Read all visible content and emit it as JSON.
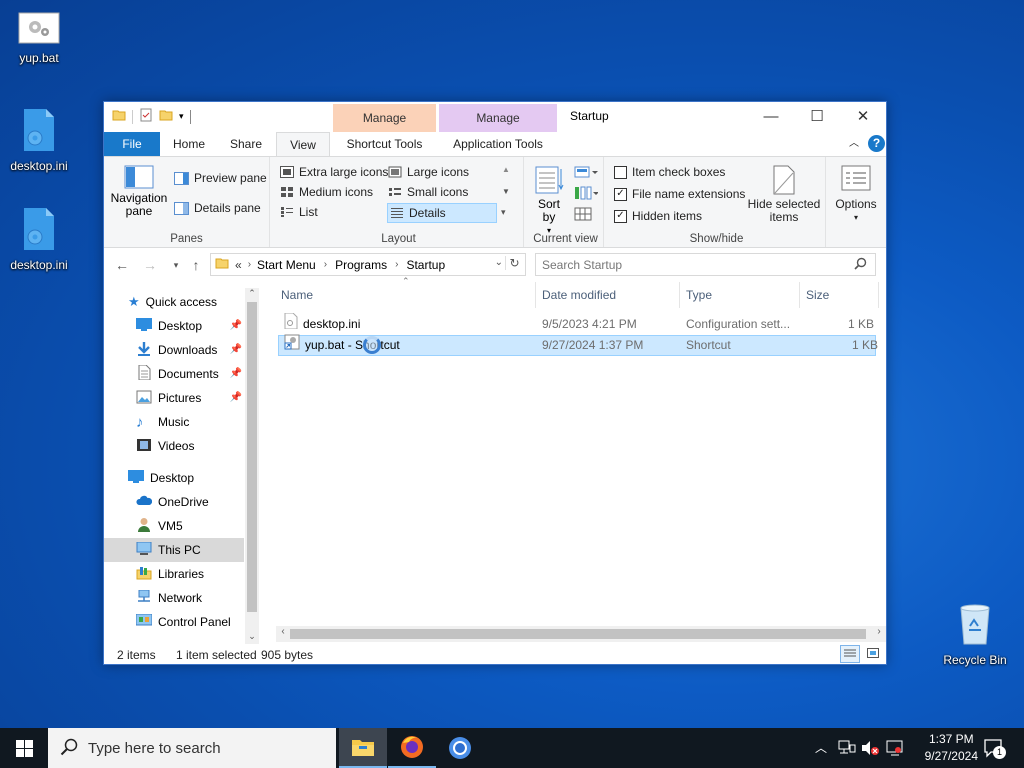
{
  "desktop": {
    "icons": [
      {
        "label": "yup.bat"
      },
      {
        "label": "desktop.ini"
      },
      {
        "label": "desktop.ini"
      },
      {
        "label": "Recycle Bin"
      }
    ]
  },
  "window": {
    "title": "Startup",
    "context_tabs": [
      {
        "group": "Manage",
        "tab": "Shortcut Tools",
        "color": "#fbd2b8"
      },
      {
        "group": "Manage",
        "tab": "Application Tools",
        "color": "#e4c9f2"
      }
    ],
    "tabs": [
      "File",
      "Home",
      "Share",
      "View"
    ],
    "active_tab": "View",
    "controls": {
      "minimize": "—",
      "maximize": "☐",
      "close": "✕",
      "help": "?"
    }
  },
  "ribbon": {
    "panes": {
      "nav_pane": "Navigation pane",
      "preview_pane": "Preview pane",
      "details_pane": "Details pane",
      "label": "Panes"
    },
    "layout": {
      "items": [
        "Extra large icons",
        "Large icons",
        "Medium icons",
        "Small icons",
        "List",
        "Details"
      ],
      "selected": "Details",
      "label": "Layout"
    },
    "current_view": {
      "sort_by": "Sort by",
      "label": "Current view"
    },
    "show_hide": {
      "item_check_boxes": {
        "label": "Item check boxes",
        "checked": false
      },
      "file_name_extensions": {
        "label": "File name extensions",
        "checked": true
      },
      "hidden_items": {
        "label": "Hidden items",
        "checked": true
      },
      "hide_selected": "Hide selected items",
      "label": "Show/hide"
    },
    "options": "Options"
  },
  "address": {
    "prefix": "«",
    "crumbs": [
      "Start Menu",
      "Programs",
      "Startup"
    ],
    "search_placeholder": "Search Startup"
  },
  "nav": {
    "items": [
      {
        "label": "Quick access",
        "pinned": false
      },
      {
        "label": "Desktop",
        "pinned": true
      },
      {
        "label": "Downloads",
        "pinned": true
      },
      {
        "label": "Documents",
        "pinned": true
      },
      {
        "label": "Pictures",
        "pinned": true
      },
      {
        "label": "Music",
        "pinned": false
      },
      {
        "label": "Videos",
        "pinned": false
      },
      {
        "label": "Desktop",
        "pinned": false
      },
      {
        "label": "OneDrive",
        "pinned": false
      },
      {
        "label": "VM5",
        "pinned": false
      },
      {
        "label": "This PC",
        "pinned": false
      },
      {
        "label": "Libraries",
        "pinned": false
      },
      {
        "label": "Network",
        "pinned": false
      },
      {
        "label": "Control Panel",
        "pinned": false
      }
    ],
    "selected": "This PC"
  },
  "files": {
    "columns": [
      "Name",
      "Date modified",
      "Type",
      "Size"
    ],
    "rows": [
      {
        "name": "desktop.ini",
        "date": "9/5/2023 4:21 PM",
        "type": "Configuration sett...",
        "size": "1 KB",
        "selected": false
      },
      {
        "name": "yup.bat - Shortcut",
        "date": "9/27/2024 1:37 PM",
        "type": "Shortcut",
        "size": "1 KB",
        "selected": true
      }
    ]
  },
  "status": {
    "count": "2 items",
    "selection": "1 item selected",
    "bytes": "905 bytes"
  },
  "taskbar": {
    "search_placeholder": "Type here to search",
    "time": "1:37 PM",
    "date": "9/27/2024",
    "notification_count": "1"
  }
}
